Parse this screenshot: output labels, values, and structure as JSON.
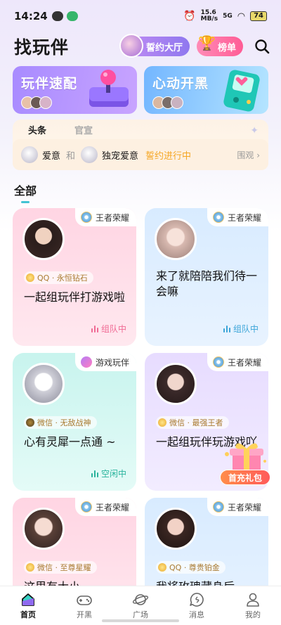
{
  "status_bar": {
    "time": "14:24",
    "speed": "15.6\nMB/s",
    "network": "5G",
    "battery": "74"
  },
  "header": {
    "title": "找玩伴",
    "hall_label": "誓约大厅",
    "rank_label": "榜单"
  },
  "banners": [
    {
      "title": "玩伴速配"
    },
    {
      "title": "心动开黑"
    }
  ],
  "news": {
    "tabs": [
      "头条",
      "官宣"
    ],
    "user_a": "爱意",
    "and_word": "和",
    "user_b": "独宠爱意",
    "status": "誓约进行中",
    "watch": "围观"
  },
  "section": {
    "title": "全部"
  },
  "cards": [
    {
      "game": "王者荣耀",
      "game_icon": "honor-of-kings-icon",
      "platform": "QQ · 永恒钻石",
      "text": "一起组玩伴打游戏啦",
      "status": "组队中"
    },
    {
      "game": "王者荣耀",
      "game_icon": "honor-of-kings-icon",
      "platform": "",
      "text": "来了就陪陪我们待一会嘛",
      "status": "组队中"
    },
    {
      "game": "游戏玩伴",
      "game_icon": "game-buddy-icon",
      "platform": "微信 · 无敌战神",
      "text": "心有灵犀一点通 ~",
      "status": "空闲中"
    },
    {
      "game": "王者荣耀",
      "game_icon": "honor-of-kings-icon",
      "platform": "微信 · 最强王者",
      "text": "一起组玩伴玩游戏吖",
      "status": ""
    },
    {
      "game": "王者荣耀",
      "game_icon": "honor-of-kings-icon",
      "platform": "微信 · 至尊星耀",
      "text": "这里有大小",
      "status": ""
    },
    {
      "game": "王者荣耀",
      "game_icon": "honor-of-kings-icon",
      "platform": "QQ · 尊贵铂金",
      "text": "我将玫瑰藏身后",
      "status": ""
    }
  ],
  "gift": {
    "label": "首充礼包"
  },
  "tabbar": [
    {
      "label": "首页",
      "icon": "home-icon"
    },
    {
      "label": "开黑",
      "icon": "gamepad-icon"
    },
    {
      "label": "广场",
      "icon": "planet-icon"
    },
    {
      "label": "消息",
      "icon": "message-icon"
    },
    {
      "label": "我的",
      "icon": "profile-icon"
    }
  ],
  "colors": {
    "accent_teal": "#41c3d3",
    "status_pink": "#f06a94",
    "status_blue": "#3aa4d8",
    "status_teal": "#29b39c",
    "gold": "#f5a623"
  }
}
